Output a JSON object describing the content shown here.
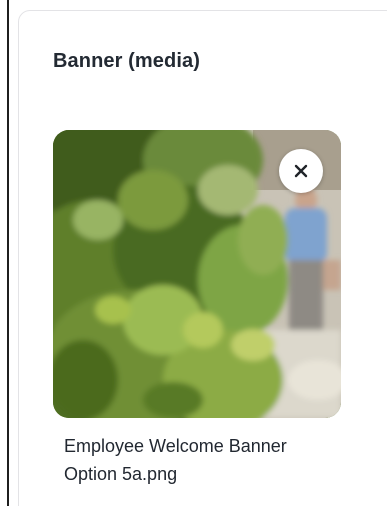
{
  "card": {
    "title": "Banner (media)"
  },
  "media": {
    "file_name": "Employee Welcome Banner Option 5a.png",
    "remove_icon": "close-icon"
  }
}
